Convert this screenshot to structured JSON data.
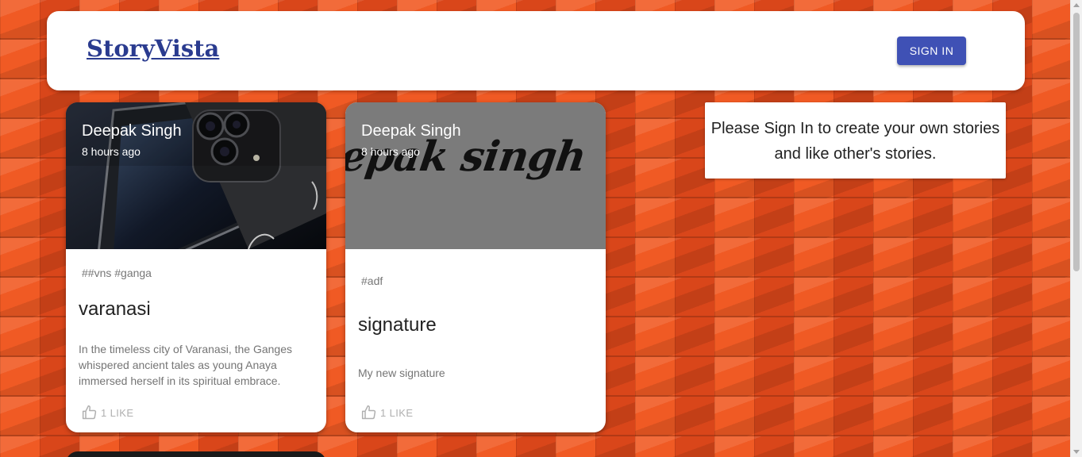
{
  "header": {
    "brand": "StoryVista",
    "signin_label": "SIGN IN"
  },
  "stories": [
    {
      "author": "Deepak Singh",
      "time": "8 hours ago",
      "tags": "##vns #ganga",
      "title": "varanasi",
      "description": "In the timeless city of Varanasi, the Ganges whispered ancient tales as young Anaya immersed herself in its spiritual embrace.",
      "likes": "1 LIKE",
      "image": "smartphone-photo"
    },
    {
      "author": "Deepak Singh",
      "time": "8 hours ago",
      "tags": "#adf",
      "title": "signature",
      "description": "My new signature",
      "likes": "1 LIKE",
      "image": "handwritten-signature",
      "image_text": "epak singh"
    }
  ],
  "info": {
    "message": "Please Sign In to create your own stories and like other's stories."
  },
  "colors": {
    "brand": "#2a3b8f",
    "button": "#3f51b5",
    "background": "#e8501e"
  }
}
